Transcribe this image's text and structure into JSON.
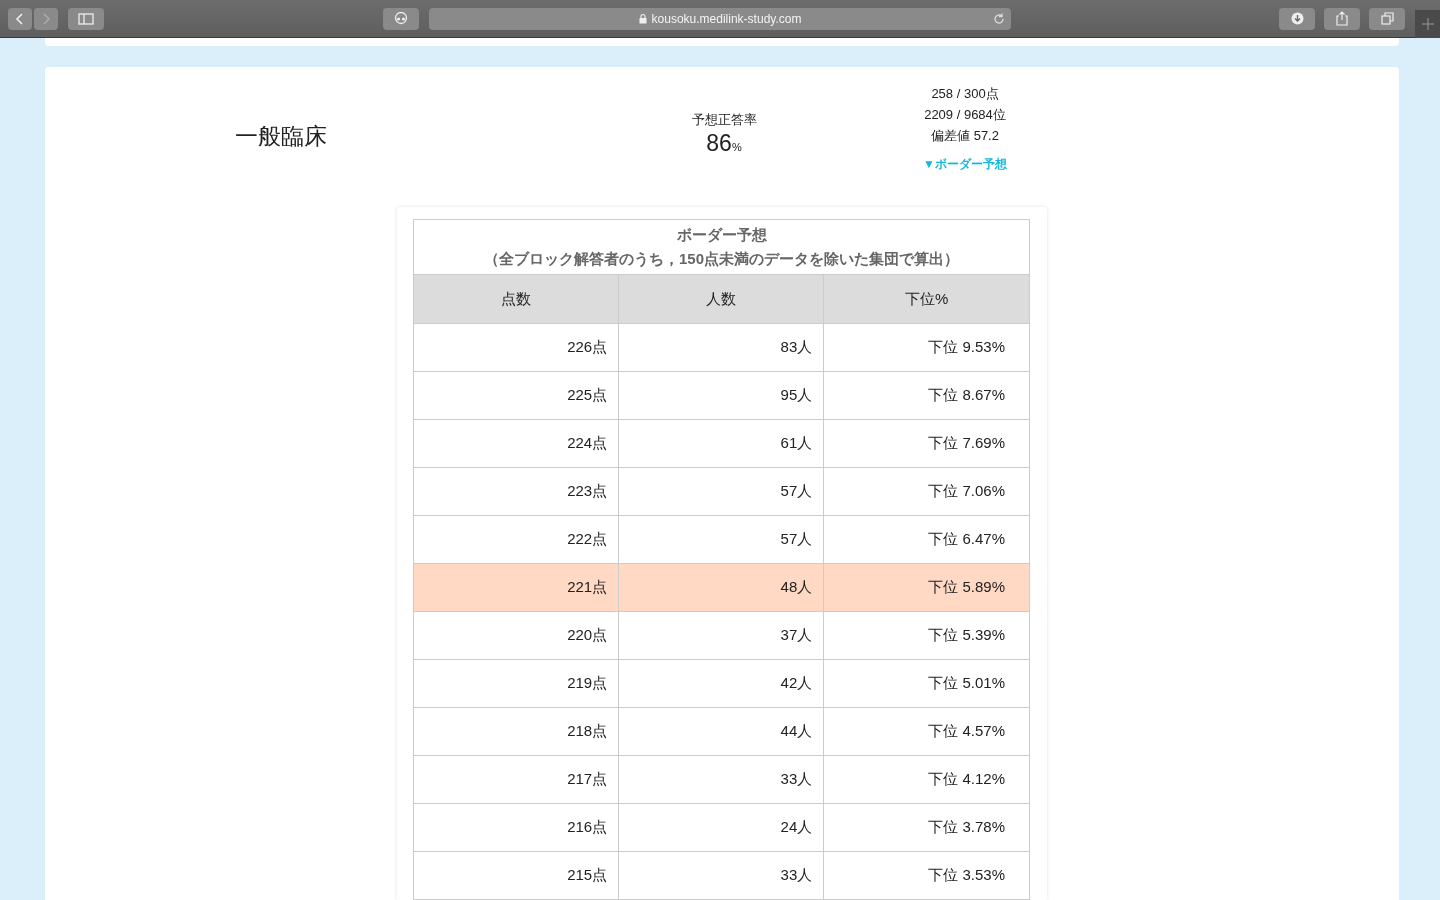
{
  "browser": {
    "url": "kousoku.medilink-study.com"
  },
  "subject": {
    "title": "一般臨床"
  },
  "accuracy": {
    "label": "予想正答率",
    "value": "86",
    "unit": "%"
  },
  "score": {
    "lines": [
      "258 / 300点",
      "2209 / 9684位",
      "偏差値 57.2"
    ],
    "link": "▼ボーダー予想"
  },
  "table": {
    "caption_title": "ボーダー予想",
    "caption_note": "（全ブロック解答者のうち，150点未満のデータを除いた集団で算出）",
    "columns": [
      "点数",
      "人数",
      "下位%"
    ],
    "rows": [
      {
        "cells": [
          "226点",
          "83人",
          "下位 9.53%"
        ],
        "selected": false
      },
      {
        "cells": [
          "225点",
          "95人",
          "下位 8.67%"
        ],
        "selected": false
      },
      {
        "cells": [
          "224点",
          "61人",
          "下位 7.69%"
        ],
        "selected": false
      },
      {
        "cells": [
          "223点",
          "57人",
          "下位 7.06%"
        ],
        "selected": false
      },
      {
        "cells": [
          "222点",
          "57人",
          "下位 6.47%"
        ],
        "selected": false
      },
      {
        "cells": [
          "221点",
          "48人",
          "下位 5.89%"
        ],
        "selected": true
      },
      {
        "cells": [
          "220点",
          "37人",
          "下位 5.39%"
        ],
        "selected": false
      },
      {
        "cells": [
          "219点",
          "42人",
          "下位 5.01%"
        ],
        "selected": false
      },
      {
        "cells": [
          "218点",
          "44人",
          "下位 4.57%"
        ],
        "selected": false
      },
      {
        "cells": [
          "217点",
          "33人",
          "下位 4.12%"
        ],
        "selected": false
      },
      {
        "cells": [
          "216点",
          "24人",
          "下位 3.78%"
        ],
        "selected": false
      },
      {
        "cells": [
          "215点",
          "33人",
          "下位 3.53%"
        ],
        "selected": false
      }
    ]
  }
}
